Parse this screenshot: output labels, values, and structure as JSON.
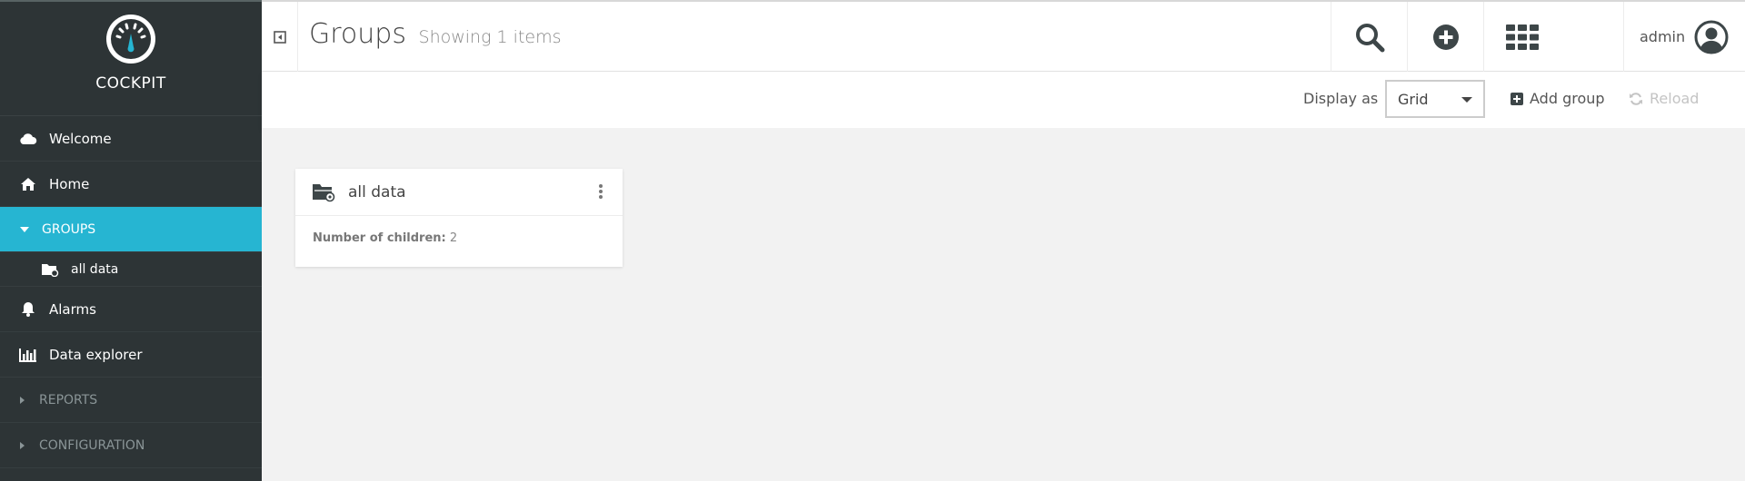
{
  "app": {
    "name": "COCKPIT"
  },
  "sidebar": {
    "items": [
      {
        "label": "Welcome",
        "icon": "cloud-icon"
      },
      {
        "label": "Home",
        "icon": "home-icon"
      },
      {
        "label": "GROUPS",
        "icon": "caret-down-icon",
        "active": true
      },
      {
        "label": "all data",
        "icon": "folder-icon",
        "sub": true
      },
      {
        "label": "Alarms",
        "icon": "bell-icon"
      },
      {
        "label": "Data explorer",
        "icon": "bar-chart-icon"
      },
      {
        "label": "REPORTS",
        "icon": "caret-right-icon"
      },
      {
        "label": "CONFIGURATION",
        "icon": "caret-right-icon"
      }
    ]
  },
  "header": {
    "title": "Groups",
    "subtitle": "Showing 1 items",
    "user": "admin"
  },
  "toolbar": {
    "display_label": "Display as",
    "display_value": "Grid",
    "add_label": "Add group",
    "reload_label": "Reload"
  },
  "cards": [
    {
      "title": "all data",
      "children_label": "Number of children:",
      "children_value": "2"
    }
  ],
  "colors": {
    "sidebar_bg": "#2d3436",
    "accent": "#26b5d2",
    "content_bg": "#f2f2f2"
  }
}
